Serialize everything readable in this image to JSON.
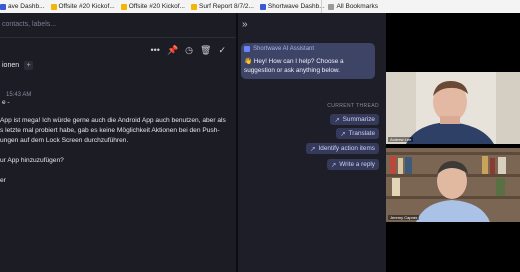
{
  "bookmarks": {
    "items": [
      {
        "label": "ave Dashb...",
        "color": "#3a57d6"
      },
      {
        "label": "Offsite #20 Kickof...",
        "color": "#f2b705"
      },
      {
        "label": "Offsite #20 Kickof...",
        "color": "#f2b705"
      },
      {
        "label": "Surf Report 8/7/2...",
        "color": "#f2b705"
      },
      {
        "label": "Shortwave Dashb...",
        "color": "#3a57d6"
      }
    ],
    "all_bookmarks": "All Bookmarks"
  },
  "email": {
    "search_text": "contacts, labels...",
    "label_tab": "ionen",
    "add_label": "+",
    "timestamp": "15:43 AM",
    "from_line": "e -",
    "body_lines": [
      "App ist mega! Ich würde gerne auch die Android App auch benutzen, aber als",
      "s letzte mal probiert habe, gab es keine Möglichkeit Aktionen bei den Push-",
      "ungen auf dem Lock Screen durchzuführen.",
      "",
      "ur App hinzuzufügen?",
      "",
      "er"
    ],
    "toolbar": {
      "more": "•••",
      "pin": "📌",
      "snooze": "◷",
      "delete": "🗑",
      "done": "✓"
    }
  },
  "assistant": {
    "collapse_label": "»",
    "title": "Shortwave AI Assistant",
    "greeting": "👋 Hey! How can I help? Choose a suggestion or ask anything below.",
    "current_thread_label": "CURRENT THREAD",
    "suggestions": [
      {
        "arrow": "↗",
        "label": "Summarize"
      },
      {
        "arrow": "↗",
        "label": "Translate"
      },
      {
        "arrow": "↗",
        "label": "Identify action items"
      },
      {
        "arrow": "↗",
        "label": "Write a reply"
      }
    ]
  },
  "video": {
    "participant1": "Andrew Lee",
    "participant2": "Jeremy Capner"
  }
}
